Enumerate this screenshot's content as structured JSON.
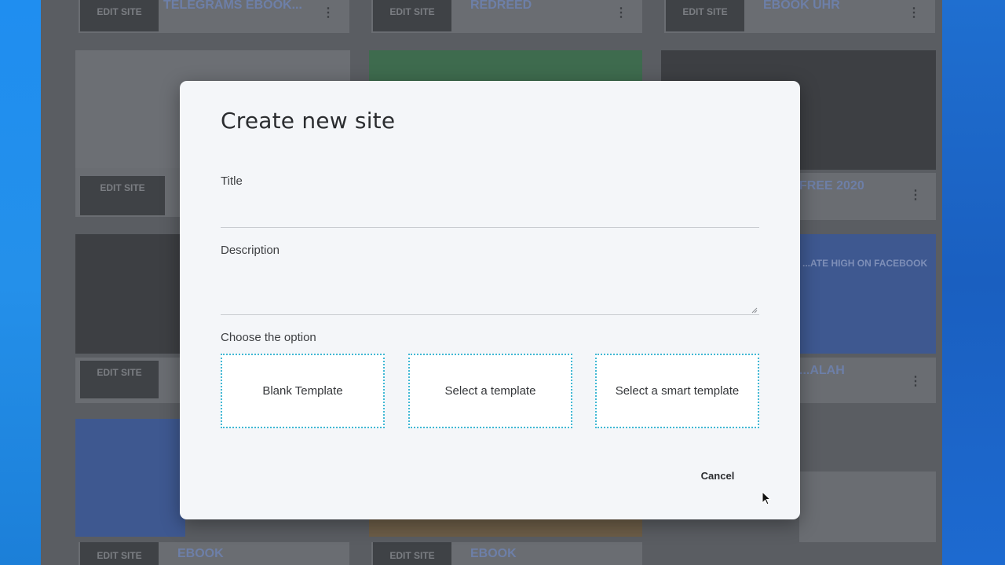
{
  "modal": {
    "title": "Create new site",
    "title_field": {
      "label": "Title",
      "value": "",
      "placeholder": ""
    },
    "description_field": {
      "label": "Description",
      "value": "",
      "placeholder": ""
    },
    "option_label": "Choose the option",
    "options": [
      {
        "label": "Blank Template"
      },
      {
        "label": "Select a template"
      },
      {
        "label": "Select a smart template"
      }
    ],
    "cancel_label": "Cancel",
    "option_border_color": "#41b8d4"
  },
  "background": {
    "edit_button_label": "EDIT SITE",
    "card_titles": [
      "TELEGRAMS EBOOK...",
      "REDREED",
      "EBOOK UHR",
      "FREE 2020",
      "...ATE HIGH ON FACEBOOK",
      "...ALAH",
      "EBOOK",
      "EBOOK"
    ]
  },
  "colors": {
    "overlay": "#5a5d62",
    "modal_bg": "#f4f6f9",
    "desktop_blue": "#1f8ef0"
  },
  "icons": [
    "more-vertical-icon",
    "mouse-cursor-icon",
    "resize-grip-icon"
  ]
}
